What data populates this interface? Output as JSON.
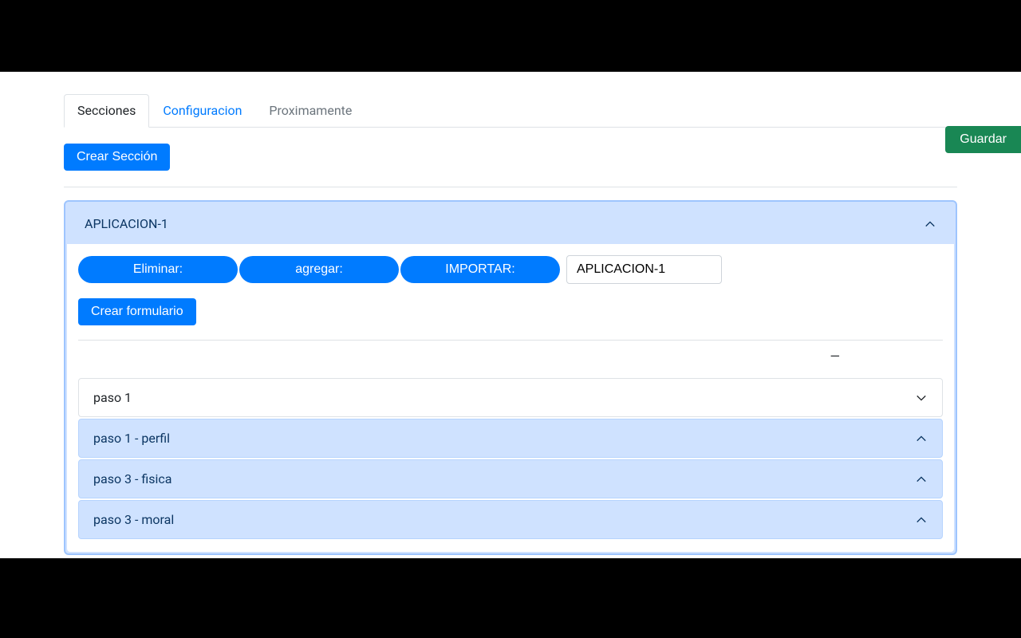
{
  "tabs": {
    "secciones": "Secciones",
    "configuracion": "Configuracion",
    "proximamente": "Proximamente"
  },
  "buttons": {
    "save": "Guardar",
    "createSection": "Crear Sección",
    "createForm": "Crear formulario",
    "eliminar": "Eliminar:",
    "agregar": "agregar:",
    "importar": "IMPORTAR:"
  },
  "section": {
    "name": "APLICACION-1",
    "input_value": "APLICACION-1"
  },
  "forms": [
    {
      "label": "paso 1",
      "expanded": false
    },
    {
      "label": "paso 1 - perfil",
      "expanded": true
    },
    {
      "label": "paso 3 - fisica",
      "expanded": true
    },
    {
      "label": "paso 3 - moral",
      "expanded": true
    }
  ],
  "dash": "—"
}
